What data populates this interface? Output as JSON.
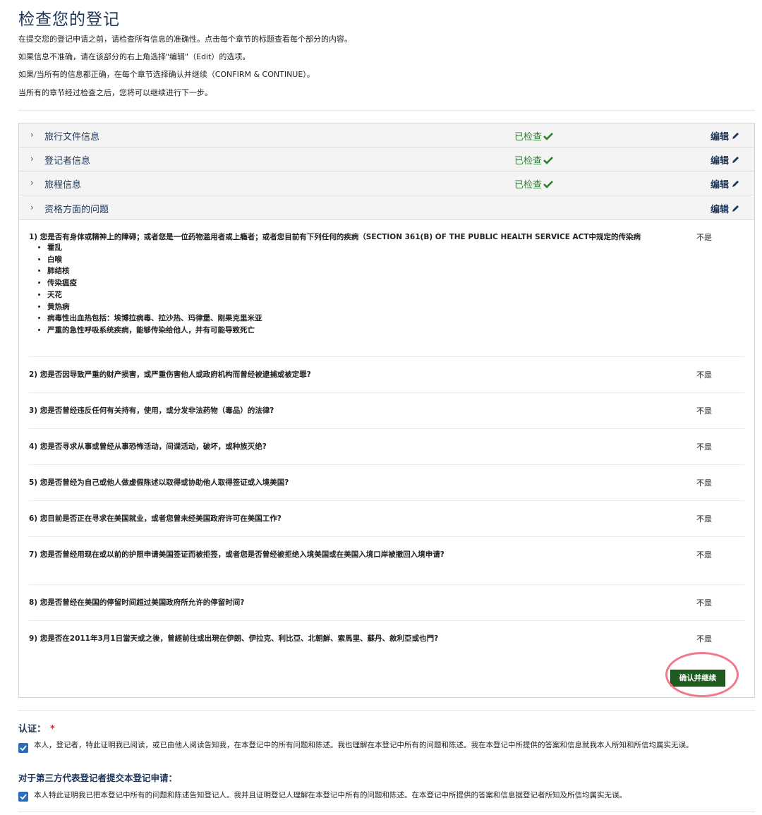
{
  "page": {
    "title": "检查您的登记",
    "intro": [
      "在提交您的登记申请之前，请检查所有信息的准确性。点击每个章节的标题查看每个部分的内容。",
      "如果信息不准确，请在该部分的右上角选择\"编辑\"（Edit）的选项。",
      "如果/当所有的信息都正确，在每个章节选择确认并继续（CONFIRM & CONTINUE）。",
      "当所有的章节经过检查之后，您将可以继续进行下一步。"
    ]
  },
  "sections": [
    {
      "title": "旅行文件信息",
      "status": "已检查",
      "edit": "编辑"
    },
    {
      "title": "登记者信息",
      "status": "已检查",
      "edit": "编辑"
    },
    {
      "title": "旅程信息",
      "status": "已检查",
      "edit": "编辑"
    },
    {
      "title": "资格方面的问题",
      "status": "",
      "edit": "编辑"
    }
  ],
  "questions": [
    {
      "text": "1) 您是否有身体或精神上的障碍；或者您是一位药物滥用者或上瘾者；或者您目前有下列任何的疾病（SECTION 361(B) OF THE PUBLIC HEALTH SERVICE ACT中规定的传染病",
      "answer": "不是"
    },
    {
      "text": "2) 您是否因导致严重的财产损害，或严重伤害他人或政府机构而曾经被逮捕或被定罪?",
      "answer": "不是"
    },
    {
      "text": "3) 您是否曾经违反任何有关持有，使用，或分发非法药物（毒品）的法律?",
      "answer": "不是"
    },
    {
      "text": "4) 您是否寻求从事或曾经从事恐怖活动，间谍活动，破坏，或种族灭绝?",
      "answer": "不是"
    },
    {
      "text": "5) 您是否曾经为自己或他人做虚假陈述以取得或协助他人取得签证或入境美国?",
      "answer": "不是"
    },
    {
      "text": "6) 您目前是否正在寻求在美国就业，或者您曾未经美国政府许可在美国工作?",
      "answer": "不是"
    },
    {
      "text": "7) 您是否曾经用现在或以前的护照申请美国签证而被拒签，或者您是否曾经被拒绝入境美国或在美国入境口岸被撤回入境申请?",
      "answer": "不是"
    },
    {
      "text": "8) 您是否曾经在美国的停留时间超过美国政府所允许的停留时间?",
      "answer": "不是"
    },
    {
      "text": "9) 您是否在2011年3月1日當天或之後，曾經前往或出現在伊朗、伊拉克、利比亞、北朝鮮、索馬里、蘇丹、敘利亞或也門?",
      "answer": "不是"
    }
  ],
  "diseases": [
    "霍乱",
    "白喉",
    "肺结核",
    "传染瘟疫",
    "天花",
    "黄热病",
    "病毒性出血热包括：埃博拉病毒、拉沙热、玛律堡、刚果克里米亚",
    "严重的急性呼吸系统疾病，能够传染给他人，并有可能导致死亡"
  ],
  "confirm_button": "确认并继续",
  "certification": {
    "label": "认证：",
    "required_mark": "*",
    "text": "本人，登记者，特此证明我已阅读，或已由他人阅读告知我，在本登记中的所有问题和陈述。我也理解在本登记中所有的问题和陈述。我在本登记中所提供的答案和信息就我本人所知和所信均属实无误。",
    "checked": true
  },
  "third_party": {
    "label": "对于第三方代表登记者提交本登记申请：",
    "text": "本人特此证明我已把本登记中所有的问题和陈述告知登记人。我并且证明登记人理解在本登记中所有的问题和陈述。在本登记中所提供的答案和信息据登记者所知及所信均属实无误。",
    "checked": true
  },
  "colors": {
    "accent": "#1d3557",
    "success": "#2e7d32",
    "button": "#1f5c1f",
    "checkbox": "#2a6ebb",
    "highlight": "#f07a8c"
  }
}
